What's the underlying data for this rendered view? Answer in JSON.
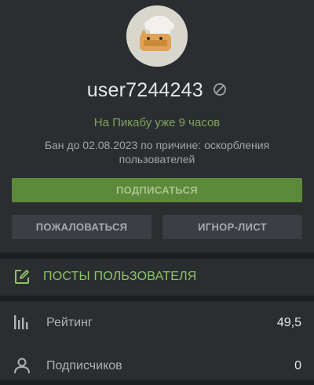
{
  "profile": {
    "username": "user7244243",
    "since_text": "На Пикабу уже 9 часов",
    "ban_text": "Бан до 02.08.2023 по причине: оскорбления пользователей",
    "subscribe_label": "ПОДПИСАТЬСЯ",
    "report_label": "ПОЖАЛОВАТЬСЯ",
    "ignore_label": "ИГНОР-ЛИСТ"
  },
  "posts": {
    "label": "ПОСТЫ ПОЛЬЗОВАТЕЛЯ",
    "icon": "edit-square-icon"
  },
  "stats": [
    {
      "label": "Рейтинг",
      "value": "49,5",
      "icon": "bar-chart-icon"
    },
    {
      "label": "Подписчиков",
      "value": "0",
      "icon": "person-icon"
    }
  ],
  "colors": {
    "accent_green": "#8cc660",
    "subscribe_button": "#5d8a3a",
    "panel": "#2b2e31",
    "background": "#1c1e20"
  }
}
